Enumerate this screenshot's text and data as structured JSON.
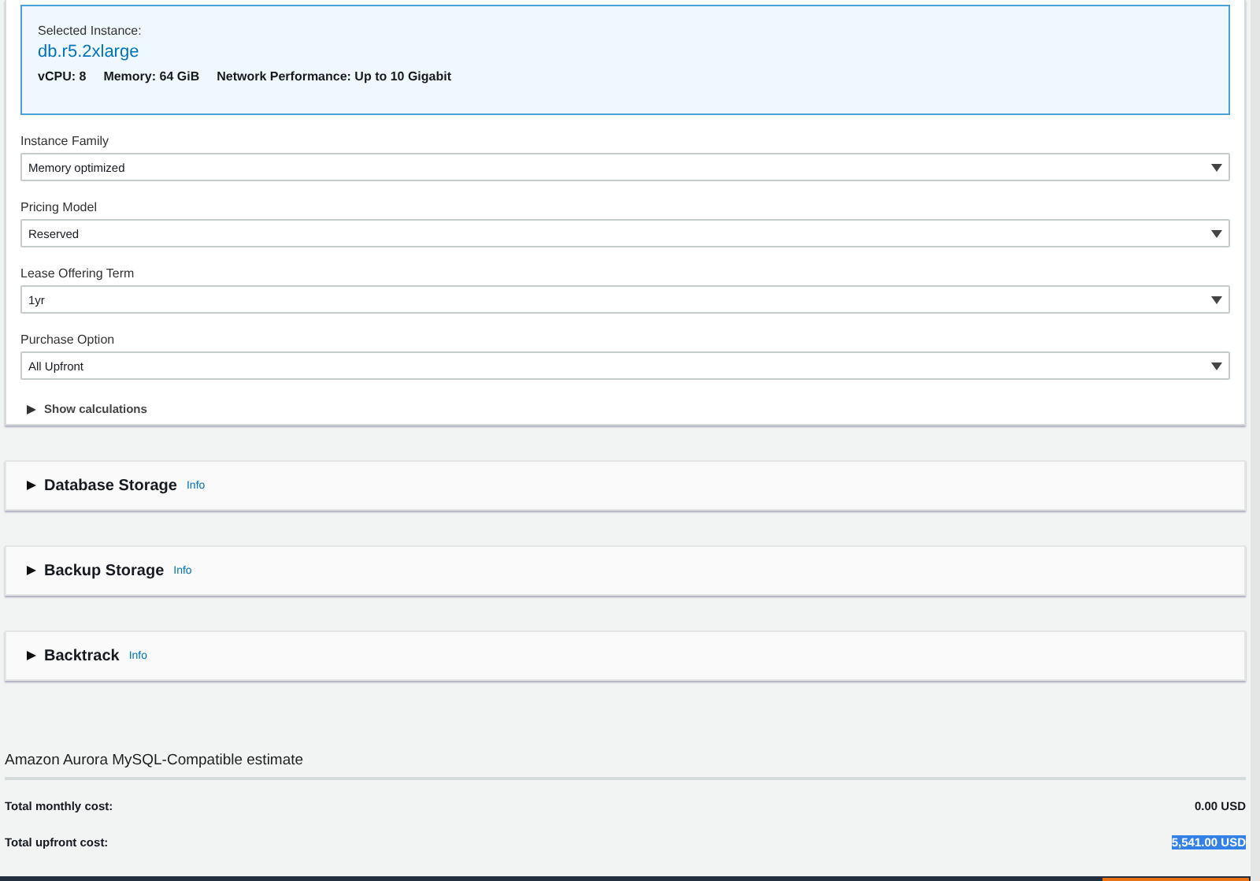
{
  "selected_instance": {
    "label": "Selected Instance:",
    "name": "db.r5.2xlarge",
    "specs": [
      "vCPU: 8",
      "Memory: 64 GiB",
      "Network Performance: Up to 10 Gigabit"
    ]
  },
  "fields": [
    {
      "label": "Instance Family",
      "value": "Memory optimized"
    },
    {
      "label": "Pricing Model",
      "value": "Reserved"
    },
    {
      "label": "Lease Offering Term",
      "value": "1yr"
    },
    {
      "label": "Purchase Option",
      "value": "All Upfront"
    }
  ],
  "show_calculations": {
    "label": "Show calculations",
    "expanded": false
  },
  "sections": [
    {
      "title": "Database Storage",
      "info": "Info",
      "expanded": false
    },
    {
      "title": "Backup Storage",
      "info": "Info",
      "expanded": false
    },
    {
      "title": "Backtrack",
      "info": "Info",
      "expanded": false
    }
  ],
  "estimate": {
    "title": "Amazon Aurora MySQL-Compatible estimate",
    "rows": [
      {
        "label": "Total monthly cost:",
        "value": "0.00 USD",
        "highlighted": false
      },
      {
        "label": "Total upfront cost:",
        "value": "5,541.00 USD",
        "highlighted": true
      }
    ]
  }
}
